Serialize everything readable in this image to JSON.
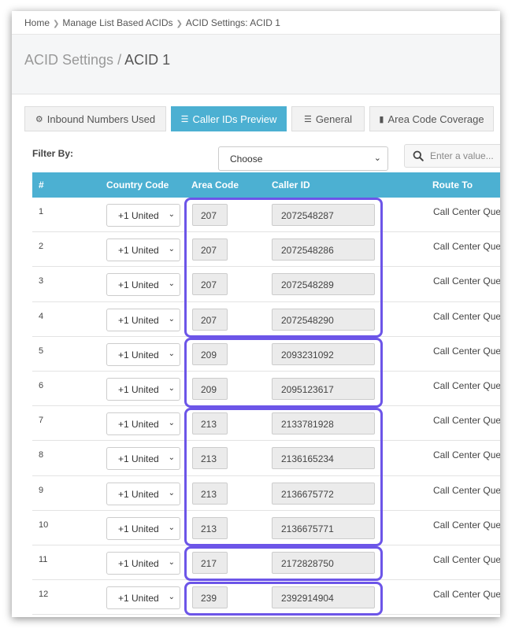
{
  "breadcrumb": [
    "Home",
    "Manage List Based ACIDs",
    "ACID Settings: ACID 1"
  ],
  "page_title": {
    "parent": "ACID Settings",
    "separator": "/",
    "current": "ACID 1"
  },
  "tabs": [
    {
      "label": "Inbound Numbers Used",
      "icon": "gear-icon",
      "active": false
    },
    {
      "label": "Caller IDs Preview",
      "icon": "list-icon",
      "active": true
    },
    {
      "label": "General",
      "icon": "list-icon",
      "active": false
    },
    {
      "label": "Area Code Coverage",
      "icon": "document-icon",
      "active": false
    }
  ],
  "filter": {
    "label": "Filter By:",
    "selected": "Choose",
    "search_placeholder": "Enter a value..."
  },
  "table": {
    "headers": {
      "num": "#",
      "country": "Country Code",
      "area": "Area Code",
      "caller": "Caller ID",
      "route": "Route To"
    },
    "rows": [
      {
        "num": "1",
        "country": "+1 United",
        "area": "207",
        "caller_id": "2072548287",
        "route": "Call Center Que"
      },
      {
        "num": "2",
        "country": "+1 United",
        "area": "207",
        "caller_id": "2072548286",
        "route": "Call Center Que"
      },
      {
        "num": "3",
        "country": "+1 United",
        "area": "207",
        "caller_id": "2072548289",
        "route": "Call Center Que"
      },
      {
        "num": "4",
        "country": "+1 United",
        "area": "207",
        "caller_id": "2072548290",
        "route": "Call Center Que"
      },
      {
        "num": "5",
        "country": "+1 United",
        "area": "209",
        "caller_id": "2093231092",
        "route": "Call Center Que"
      },
      {
        "num": "6",
        "country": "+1 United",
        "area": "209",
        "caller_id": "2095123617",
        "route": "Call Center Que"
      },
      {
        "num": "7",
        "country": "+1 United",
        "area": "213",
        "caller_id": "2133781928",
        "route": "Call Center Que"
      },
      {
        "num": "8",
        "country": "+1 United",
        "area": "213",
        "caller_id": "2136165234",
        "route": "Call Center Que"
      },
      {
        "num": "9",
        "country": "+1 United",
        "area": "213",
        "caller_id": "2136675772",
        "route": "Call Center Que"
      },
      {
        "num": "10",
        "country": "+1 United",
        "area": "213",
        "caller_id": "2136675771",
        "route": "Call Center Que"
      },
      {
        "num": "11",
        "country": "+1 United",
        "area": "217",
        "caller_id": "2172828750",
        "route": "Call Center Que"
      },
      {
        "num": "12",
        "country": "+1 United",
        "area": "239",
        "caller_id": "2392914904",
        "route": "Call Center Que"
      }
    ]
  },
  "colors": {
    "accent": "#4cb0d2",
    "highlight": "#6c55e8"
  }
}
